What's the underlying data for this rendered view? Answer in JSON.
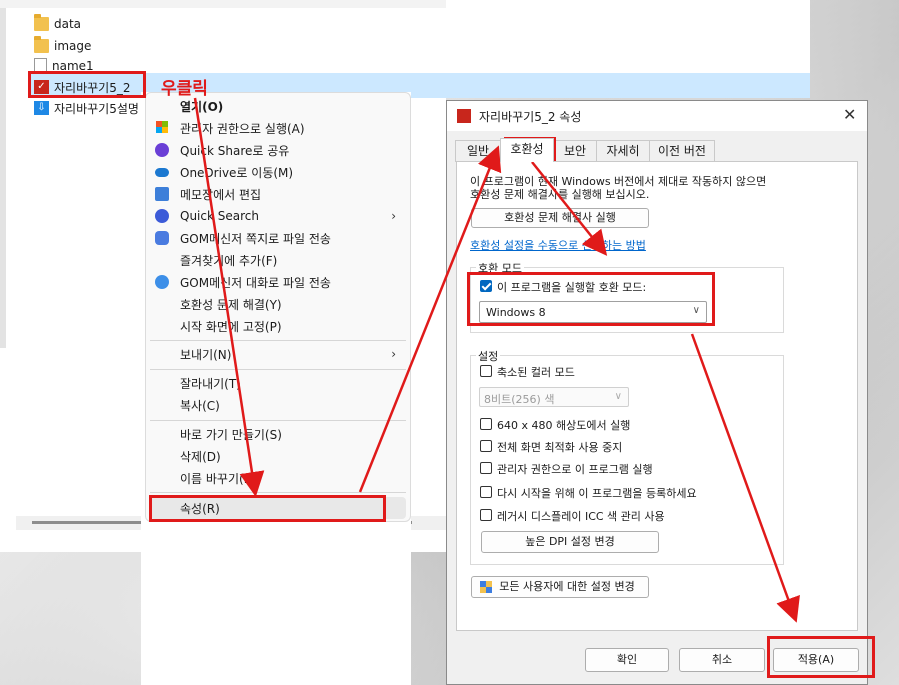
{
  "explorer": {
    "files": [
      {
        "name": "data",
        "icon": "folder-icon"
      },
      {
        "name": "image",
        "icon": "folder-icon"
      },
      {
        "name": "name1",
        "icon": "text-file-icon"
      },
      {
        "name": "자리바꾸기5_2",
        "icon": "app-icon"
      },
      {
        "name": "자리바꾸기5설명",
        "icon": "setup-icon"
      }
    ]
  },
  "annotation": {
    "right_click": "우클릭"
  },
  "context_menu": {
    "items": [
      {
        "label": "열기(O)",
        "icon": ""
      },
      {
        "label": "관리자 권한으로 실행(A)",
        "icon": "shield-icon"
      },
      {
        "label": "Quick Share로 공유",
        "icon": "quick-share-icon"
      },
      {
        "label": "OneDrive로 이동(M)",
        "icon": "onedrive-icon"
      },
      {
        "label": "메모장에서 편집",
        "icon": "notepad-icon"
      },
      {
        "label": "Quick Search",
        "icon": "quick-search-icon"
      },
      {
        "label": "GOM메신저 쪽지로 파일 전송",
        "icon": "gom-messenger-icon"
      },
      {
        "label": "즐겨찾기에 추가(F)",
        "icon": ""
      },
      {
        "label": "GOM메신저 대화로 파일 전송",
        "icon": "gom-chat-icon"
      },
      {
        "label": "호환성 문제 해결(Y)",
        "icon": ""
      },
      {
        "label": "시작 화면에 고정(P)",
        "icon": ""
      },
      {
        "label": "보내기(N)",
        "icon": ""
      },
      {
        "label": "잘라내기(T)",
        "icon": ""
      },
      {
        "label": "복사(C)",
        "icon": ""
      },
      {
        "label": "바로 가기 만들기(S)",
        "icon": ""
      },
      {
        "label": "삭제(D)",
        "icon": ""
      },
      {
        "label": "이름 바꾸기(M)",
        "icon": ""
      },
      {
        "label": "속성(R)",
        "icon": ""
      }
    ]
  },
  "dialog": {
    "title": "자리바꾸기5_2 속성",
    "close": "✕",
    "tabs": [
      "일반",
      "호환성",
      "보안",
      "자세히",
      "이전 버전"
    ],
    "intro_line1": "이 프로그램이 현재 Windows 버전에서 제대로 작동하지 않으면",
    "intro_line2": "호환성 문제 해결사를 실행해 보십시오.",
    "troubleshooter_button": "호환성 문제 해결사 실행",
    "manual_link": "호환성 설정을 수동으로 선택하는 방법",
    "compat_group": "호환 모드",
    "compat_checkbox": "이 프로그램을 실행할 호환 모드:",
    "compat_selected": "Windows 8",
    "settings_group": "설정",
    "reduced_color": "축소된 컬러 모드",
    "color_selected": "8비트(256) 색",
    "res_640": "640 x 480 해상도에서 실행",
    "disable_fullscreen": "전체 화면 최적화 사용 중지",
    "run_admin": "관리자 권한으로 이 프로그램 실행",
    "register_restart": "다시 시작을 위해 이 프로그램을 등록하세요",
    "legacy_icc": "레거시 디스플레이 ICC 색 관리 사용",
    "high_dpi_button": "높은 DPI 설정 변경",
    "all_users_button": "모든 사용자에 대한 설정 변경",
    "ok": "확인",
    "cancel": "취소",
    "apply": "적용(A)"
  },
  "colors": {
    "annotation": "#e01a1a",
    "accent": "#0067c0",
    "selection": "#cce8ff"
  }
}
